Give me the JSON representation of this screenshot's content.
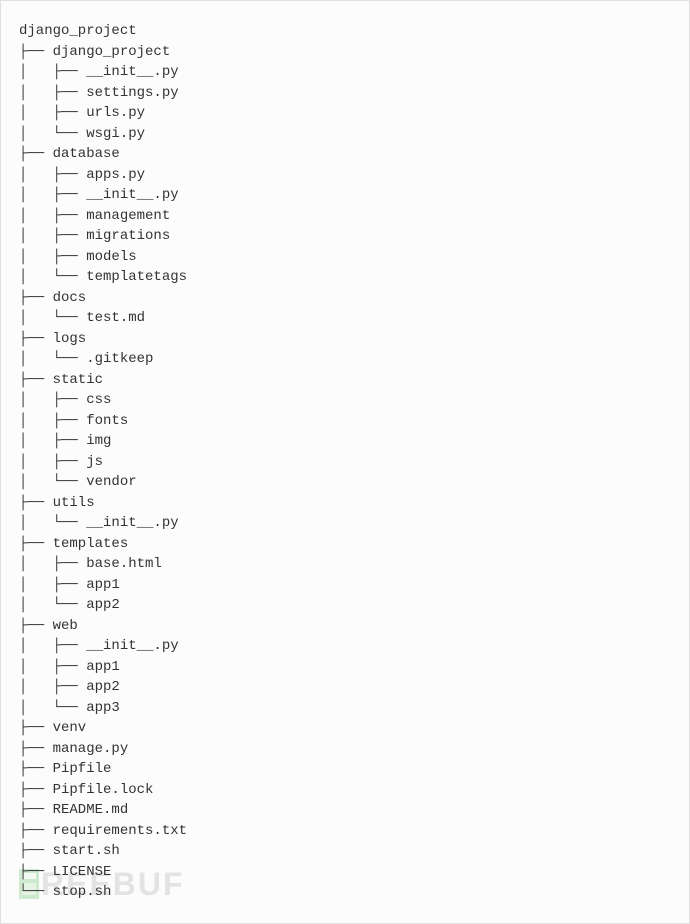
{
  "watermark": "REEBUF",
  "tree": [
    "django_project",
    "├── django_project",
    "│   ├── __init__.py",
    "│   ├── settings.py",
    "│   ├── urls.py",
    "│   └── wsgi.py",
    "├── database",
    "│   ├── apps.py",
    "│   ├── __init__.py",
    "│   ├── management",
    "│   ├── migrations",
    "│   ├── models",
    "│   └── templatetags",
    "├── docs",
    "│   └── test.md",
    "├── logs",
    "│   └── .gitkeep",
    "├── static",
    "│   ├── css",
    "│   ├── fonts",
    "│   ├── img",
    "│   ├── js",
    "│   └── vendor",
    "├── utils",
    "│   └── __init__.py",
    "├── templates",
    "│   ├── base.html",
    "│   ├── app1",
    "│   └── app2",
    "├── web",
    "│   ├── __init__.py",
    "│   ├── app1",
    "│   ├── app2",
    "│   └── app3",
    "├── venv",
    "├── manage.py",
    "├── Pipfile",
    "├── Pipfile.lock",
    "├── README.md",
    "├── requirements.txt",
    "├── start.sh",
    "├── LICENSE",
    "└── stop.sh"
  ]
}
